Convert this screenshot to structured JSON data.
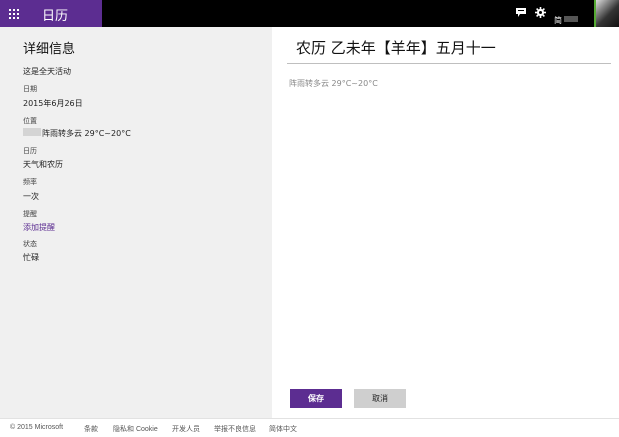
{
  "app": {
    "title": "日历"
  },
  "header": {
    "user_name": "简"
  },
  "details": {
    "heading": "详细信息",
    "all_day": "这是全天活动",
    "date_label": "日期",
    "date_value": "2015年6月26日",
    "location_label": "位置",
    "location_value": "阵雨转多云 29°C~20°C",
    "calendar_label": "日历",
    "calendar_value": "天气和农历",
    "frequency_label": "频率",
    "frequency_value": "一次",
    "reminder_label": "提醒",
    "reminder_value": "添加提醒",
    "status_label": "状态",
    "status_value": "忙碌"
  },
  "event": {
    "title": "农历 乙未年【羊年】五月十一",
    "notes": "阵雨转多云 29°C~20°C"
  },
  "actions": {
    "save_label": "保存",
    "cancel_label": "取消"
  },
  "footer": {
    "copyright": "© 2015 Microsoft",
    "terms": "条款",
    "privacy": "隐私和 Cookie",
    "developers": "开发人员",
    "report_abuse": "举报不良信息",
    "language": "简体中文"
  },
  "colors": {
    "accent": "#5c2d91",
    "topbar": "#000000",
    "panel": "#f0f0f0"
  },
  "icons": [
    "grid-icon",
    "feedback-icon",
    "settings-icon"
  ]
}
